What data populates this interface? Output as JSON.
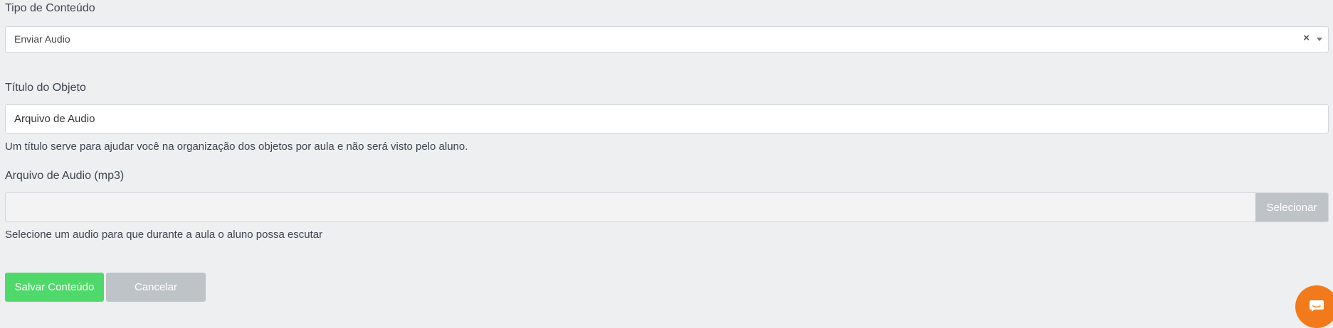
{
  "content_type": {
    "label": "Tipo de Conteúdo",
    "selected": "Enviar Audio",
    "clear_symbol": "×"
  },
  "object_title": {
    "label": "Título do Objeto",
    "value": "Arquivo de Audio",
    "help": "Um título serve para ajudar você na organização dos objetos por aula e não será visto pelo aluno."
  },
  "audio_file": {
    "label": "Arquivo de Audio (mp3)",
    "button_label": "Selecionar",
    "help": "Selecione um audio para que durante a aula o aluno possa escutar"
  },
  "actions": {
    "save_label": "Salvar Conteúdo",
    "cancel_label": "Cancelar"
  },
  "chat_widget": {
    "icon": "chat-icon",
    "color": "#f27a1a"
  }
}
